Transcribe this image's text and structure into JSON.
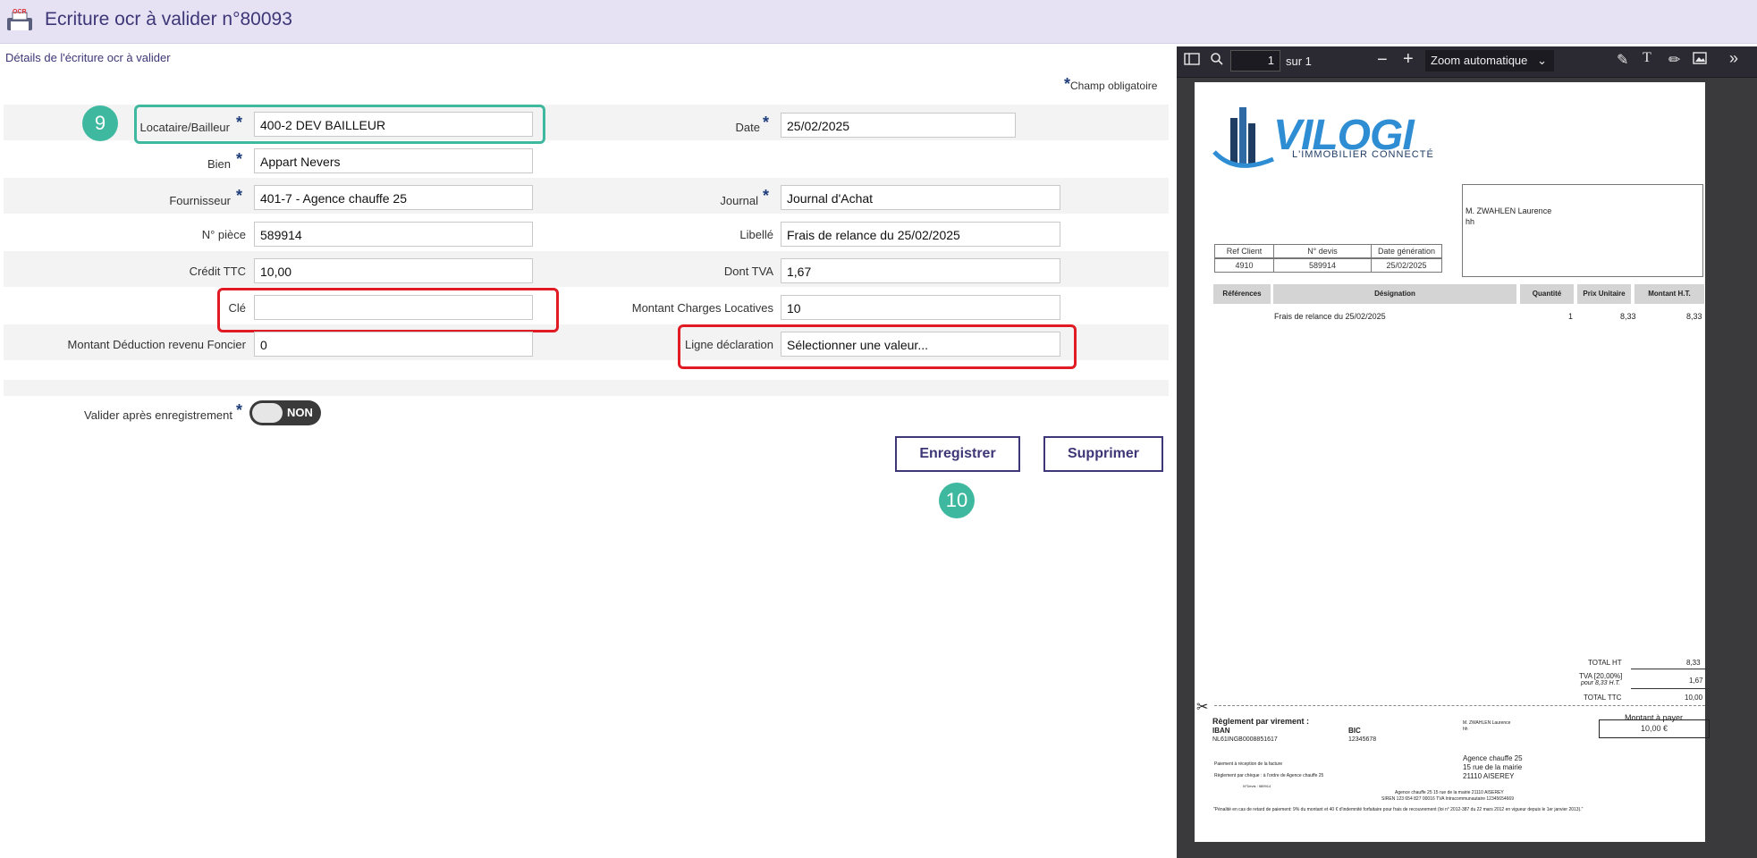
{
  "header": {
    "icon_text": "OCR",
    "title": "Ecriture ocr à valider n°80093"
  },
  "section_title": "Détails de l'écriture ocr à valider",
  "required_note": "Champ obligatoire",
  "form": {
    "locataire_label": "Locataire/Bailleur",
    "locataire_value": "400-2 DEV BAILLEUR",
    "date_label": "Date",
    "date_value": "25/02/2025",
    "bien_label": "Bien",
    "bien_value": "Appart Nevers",
    "fournisseur_label": "Fournisseur",
    "fournisseur_value": "401-7 - Agence chauffe 25",
    "journal_label": "Journal",
    "journal_value": "Journal d'Achat",
    "piece_label": "N° pièce",
    "piece_value": "589914",
    "libelle_label": "Libellé",
    "libelle_value": "Frais de relance du 25/02/2025",
    "credit_label": "Crédit TTC",
    "credit_value": "10,00",
    "tva_label": "Dont TVA",
    "tva_value": "1,67",
    "cle_label": "Clé",
    "cle_value": "",
    "charges_label": "Montant Charges Locatives",
    "charges_value": "10",
    "deduction_label": "Montant Déduction revenu Foncier",
    "deduction_value": "0",
    "ligne_label": "Ligne déclaration",
    "ligne_value": "Sélectionner une valeur...",
    "valider_label": "Valider après enregistrement",
    "toggle_text": "NON"
  },
  "buttons": {
    "save": "Enregistrer",
    "delete": "Supprimer"
  },
  "badges": {
    "b9": "9",
    "b10": "10"
  },
  "colors": {
    "accent": "#3d3677",
    "highlight_green": "#3eb9a0",
    "highlight_red": "#e01b24"
  },
  "viewer": {
    "page_value": "1",
    "page_total": "sur 1",
    "zoom": "Zoom automatique"
  },
  "pdf": {
    "logo_text": "VILOGI",
    "logo_tagline": "L'IMMOBILIER CONNECTÉ",
    "recipient_name": "M. ZWAHLEN Laurence",
    "recipient_line2": "hh",
    "ref_headers": [
      "Ref Client",
      "N° devis",
      "Date génération"
    ],
    "ref_values": [
      "4910",
      "589914",
      "25/02/2025"
    ],
    "line_headers": [
      "Références",
      "Désignation",
      "Quantité",
      "Prix Unitaire",
      "Montant H.T."
    ],
    "line_item": {
      "designation": "Frais de relance du 25/02/2025",
      "qty": "1",
      "unit": "8,33",
      "amount": "8,33"
    },
    "total_ht_label": "TOTAL HT",
    "total_ht": "8,33",
    "tva_label": "TVA [20,00%]",
    "tva_sub": "pour 8,33 H.T.",
    "tva": "1,67",
    "ttc_label": "TOTAL TTC",
    "ttc": "10,00",
    "reglement": "Règlement par virement :",
    "iban_label": "IBAN",
    "iban": "NL61INGB0008851617",
    "bic_label": "BIC",
    "bic": "12345678",
    "slip_name": "M. ZWAHLEN Laurence",
    "slip_name2": "hh",
    "montant_label": "Montant à payer",
    "montant": "10,00 €",
    "paiement_note": "Paiement à réception de la facture",
    "cheque_note": "Règlement par chèque : à l'ordre de Agence chauffe 25",
    "devis_note": "N°Devis : 589914",
    "agency_name": "Agence chauffe 25",
    "agency_street": "15 rue de la mairie",
    "agency_city": "21110 AISEREY",
    "footer1": "Agence chauffe 25 15 rue de la mairie   21110 AISEREY",
    "footer2": "SIREN 123 654 827 00016   TVA Intracommunautaire 12345654669",
    "footer3": "\"Pénalité en cas de retard de paiement: 9% du montant et 40 € d'indemnité forfaitaire pour frais de recouvrement (loi n° 2012-387 du 22 mars 2012 en vigueur depuis le 1er janvier 2013).\""
  }
}
